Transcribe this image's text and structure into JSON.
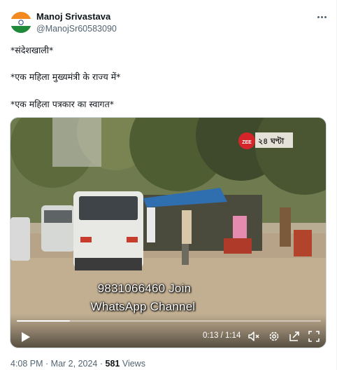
{
  "author": {
    "name": "Manoj Srivastava",
    "handle": "@ManojSr60583090"
  },
  "tweet": {
    "lines": [
      "*संदेशखाली*",
      "*एक महिला मुख्यमंत्री के राज्य में*",
      "*एक महिला पत्रकार का स्वागत*"
    ]
  },
  "video": {
    "overlay_line1": "9831066460 Join",
    "overlay_line2": "WhatsApp Channel",
    "channel_logo_text": "২৪ ঘণ্টা",
    "channel_logo_badge": "ZEE",
    "time_display": "0:13 / 1:14",
    "progress_fraction": 0.175
  },
  "meta": {
    "time": "4:08 PM",
    "date": "Mar 2, 2024",
    "separator": " · ",
    "views_count": "581",
    "views_label": " Views"
  },
  "icons": [
    "more-icon",
    "play-icon",
    "volume-icon",
    "settings-icon",
    "pip-icon",
    "fullscreen-icon"
  ],
  "colors": {
    "text_primary": "#0f1419",
    "text_secondary": "#536471",
    "border": "#cfd9de"
  }
}
